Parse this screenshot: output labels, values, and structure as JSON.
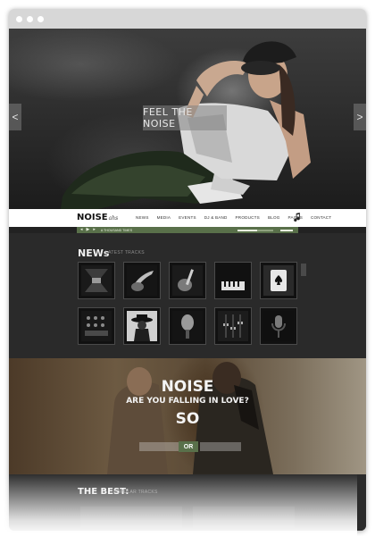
{
  "hero": {
    "tagline": "FEEL THE NOISE",
    "prev_glyph": "<",
    "next_glyph": ">"
  },
  "nav": {
    "logo": "NOISE",
    "logo_suffix": "ahs",
    "items": [
      "NEWS",
      "MEDIA",
      "EVENTS",
      "DJ & BAND",
      "PRODUCTS",
      "BLOG",
      "PAGES",
      "CONTACT"
    ]
  },
  "player": {
    "play": "▶",
    "prev": "◂",
    "next": "▸",
    "track": "A THOUSAND TIMES",
    "progress": 0.55
  },
  "news": {
    "title": "NEWs",
    "subtitle": "LATEST TRACKS",
    "thumbs": [
      "corridor-image",
      "violin-image",
      "guitar-image",
      "piano-image",
      "playing-card-image",
      "mixer-image",
      "hat-figure-image",
      "microphone-image",
      "faders-image",
      "studio-mic-image"
    ]
  },
  "promo": {
    "title": "NOISE",
    "subtitle": "ARE YOU FALLING IN LOVE?",
    "tagline": "SO",
    "left_placeholder": "",
    "or_label": "OR",
    "right_placeholder": ""
  },
  "best": {
    "title": "THE BEST:",
    "subtitle": "POPULAR TRACKS"
  },
  "colors": {
    "accent": "#59704a",
    "dark_bg": "#2a2a2a",
    "nav_bg": "#ffffff"
  }
}
